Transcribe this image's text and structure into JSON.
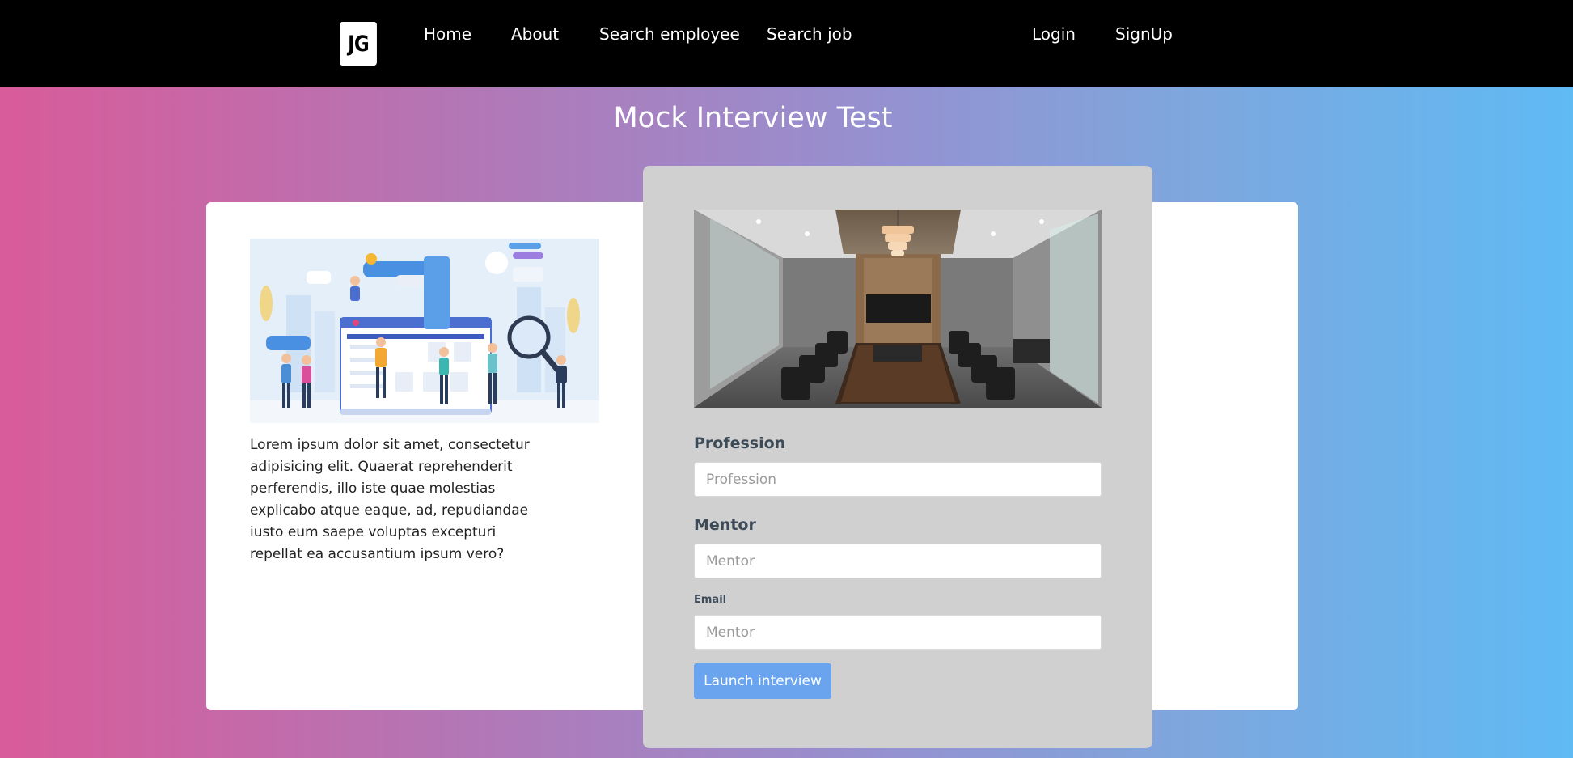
{
  "navbar": {
    "logo_text": "JG",
    "links": [
      {
        "label": "Home"
      },
      {
        "label": "About"
      },
      {
        "label": "Search employee"
      },
      {
        "label": "Search job"
      }
    ],
    "login_label": "Login",
    "signup_label": "SignUp"
  },
  "page": {
    "title": "Mock Interview Test"
  },
  "intro": {
    "text": "Lorem ipsum dolor sit amet, consectetur adipisicing elit. Quaerat reprehenderit perferendis, illo iste quae molestias explicabo atque eaque, ad, repudiandae iusto eum saepe voluptas excepturi repellat ea accusantium ipsum vero?"
  },
  "form": {
    "profession": {
      "label": "Profession",
      "placeholder": "Profession"
    },
    "mentor": {
      "label": "Mentor",
      "placeholder": "Mentor"
    },
    "email": {
      "label": "Email",
      "placeholder": "Mentor"
    },
    "submit_label": "Launch interview"
  },
  "colors": {
    "navbar": "#000000",
    "gradient_start": "#d95b9a",
    "gradient_end": "#5fbaf4",
    "form_card": "#d0d0d0",
    "button": "#6aa4ef",
    "label": "#3d4a58"
  },
  "icons": {
    "logo": "jg-logo",
    "illustration": "team-recruitment-illustration",
    "photo": "conference-room-photo"
  }
}
